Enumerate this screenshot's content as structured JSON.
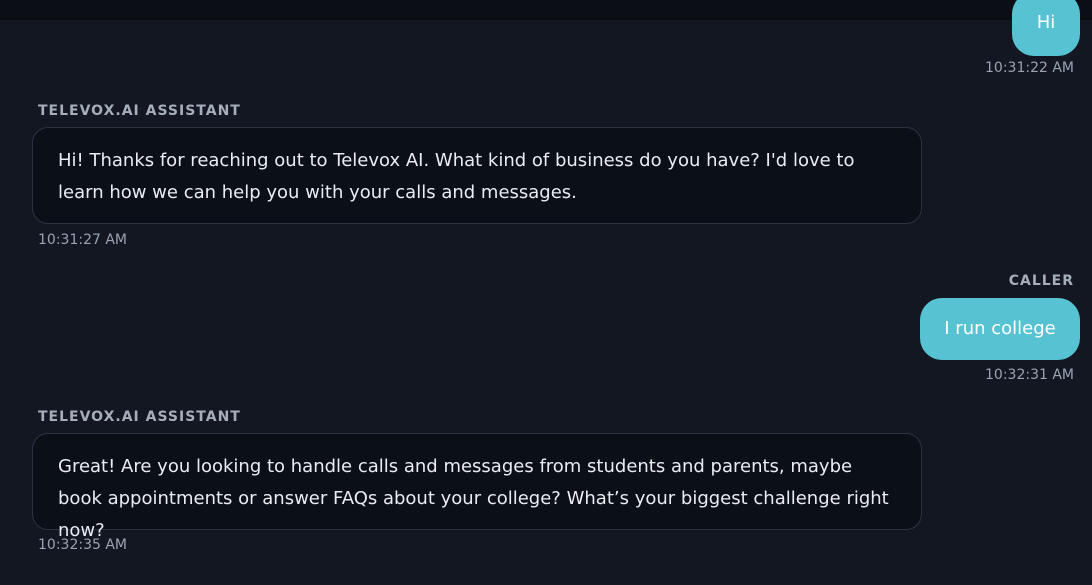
{
  "messages": [
    {
      "role": "caller",
      "text": "Hi",
      "timestamp": "10:31:22 AM"
    },
    {
      "role": "assistant",
      "sender": "TELEVOX.AI ASSISTANT",
      "text": "Hi! Thanks for reaching out to Televox AI. What kind of business do you have? I'd love to learn how we can help you with your calls and messages.",
      "timestamp": "10:31:27 AM"
    },
    {
      "role": "caller",
      "sender": "CALLER",
      "text": "I run college",
      "timestamp": "10:32:31 AM"
    },
    {
      "role": "assistant",
      "sender": "TELEVOX.AI ASSISTANT",
      "text": "Great! Are you looking to handle calls and messages from students and parents, maybe book appointments or answer FAQs about your college? What’s your biggest challenge right now?",
      "timestamp": "10:32:35 AM"
    }
  ],
  "colors": {
    "background": "#121722",
    "caller_bubble": "#57c2d2",
    "assistant_bubble": "#0b0f17",
    "muted_text": "#9aa3b3"
  }
}
